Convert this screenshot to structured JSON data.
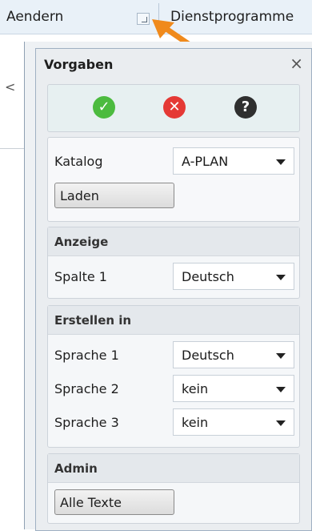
{
  "ribbon": {
    "tab_aendern": "Aendern",
    "tab_dienstprogramme": "Dienstprogramme"
  },
  "panel": {
    "title": "Vorgaben",
    "close_glyph": "×",
    "actions": {
      "ok_glyph": "✓",
      "cancel_glyph": "✕",
      "help_glyph": "?"
    },
    "katalog": {
      "label": "Katalog",
      "value": "A-PLAN",
      "load_button": "Laden"
    },
    "anzeige": {
      "header": "Anzeige",
      "spalte_label": "Spalte 1",
      "spalte_value": "Deutsch"
    },
    "erstellen": {
      "header": "Erstellen in",
      "rows": [
        {
          "label": "Sprache 1",
          "value": "Deutsch"
        },
        {
          "label": "Sprache 2",
          "value": "kein"
        },
        {
          "label": "Sprache 3",
          "value": "kein"
        }
      ]
    },
    "admin": {
      "header": "Admin",
      "button": "Alle Texte"
    }
  },
  "colors": {
    "ok": "#4cbb3f",
    "cancel": "#e53935",
    "help": "#2f2f2f",
    "arrow": "#f08a1c"
  }
}
